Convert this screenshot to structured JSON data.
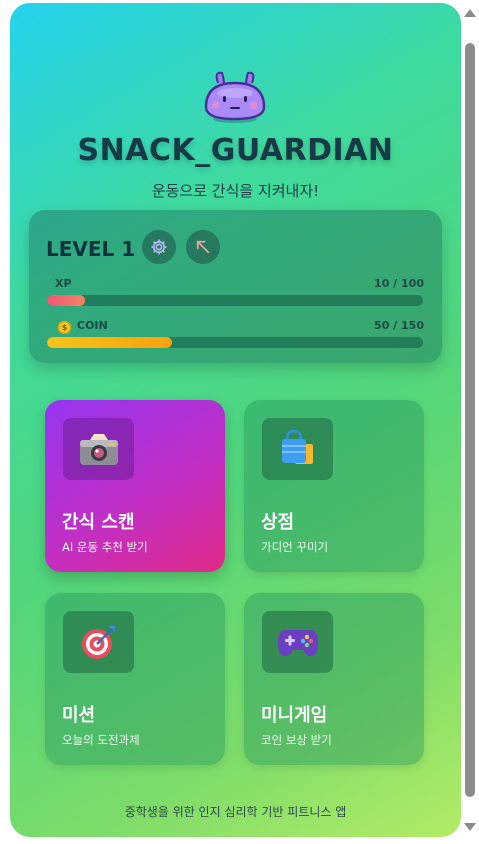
{
  "app": {
    "title": "SNACK_GUARDIAN",
    "subtitle": "운동으로 간식을 지켜내자!",
    "mascot_icon": "purple-slime-mascot"
  },
  "status": {
    "level_label": "LEVEL 1",
    "settings_icon": "gear-icon",
    "share_icon": "arrow-up-left-icon",
    "xp": {
      "label": "XP",
      "value_text": "10 / 100",
      "current": 10,
      "max": 100
    },
    "coin": {
      "label": "COIN",
      "value_text": "50 / 150",
      "current": 50,
      "max": 150
    }
  },
  "menu": [
    {
      "title": "간식 스캔",
      "subtitle": "AI 운동 추천 받기",
      "icon": "camera-icon"
    },
    {
      "title": "상점",
      "subtitle": "가디언 꾸미기",
      "icon": "shopping-bag-icon"
    },
    {
      "title": "미션",
      "subtitle": "오늘의 도전과제",
      "icon": "target-icon"
    },
    {
      "title": "미니게임",
      "subtitle": "코인 보상 받기",
      "icon": "gamepad-icon"
    }
  ],
  "footer": "중학생을 위한 인지 심리학 기반 피트니스 앱",
  "colors": {
    "xp_fill": "#f0566a",
    "coin_fill": "#f6b40e",
    "primary_tile": "#c12fc6"
  }
}
